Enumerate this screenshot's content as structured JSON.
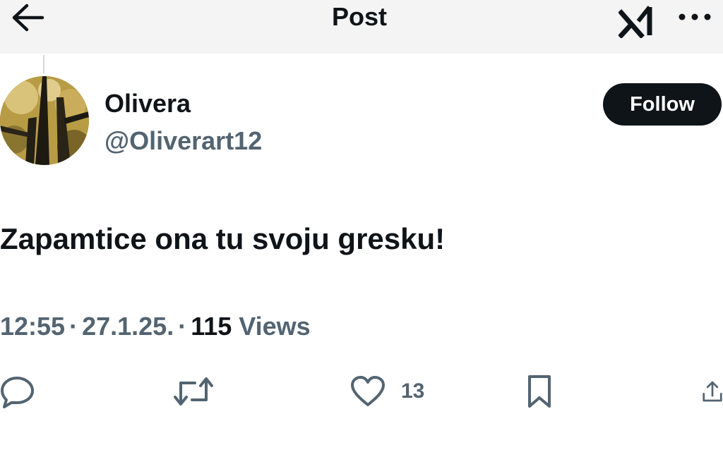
{
  "header": {
    "title": "Post",
    "back_icon": "arrow-left-icon",
    "grok_icon": "grok-logo-icon",
    "more_icon": "more-horizontal-icon"
  },
  "author": {
    "display_name": "Olivera",
    "handle": "@Oliverart12",
    "avatar_icon": "avatar-photo"
  },
  "follow_button": {
    "label": "Follow"
  },
  "post": {
    "text": "Zapamtice ona tu svoju gresku!"
  },
  "meta": {
    "time": "12:55",
    "separator": "·",
    "date": "27.1.25.",
    "views_count": "115",
    "views_label": "Views"
  },
  "actions": {
    "reply_icon": "reply-icon",
    "repost_icon": "repost-icon",
    "like_icon": "heart-icon",
    "like_count": "13",
    "bookmark_icon": "bookmark-icon",
    "share_icon": "share-icon"
  },
  "colors": {
    "text_primary": "#0f1419",
    "text_secondary": "#536471",
    "button_dark": "#0f1419",
    "header_bg": "#f4f4f4"
  }
}
